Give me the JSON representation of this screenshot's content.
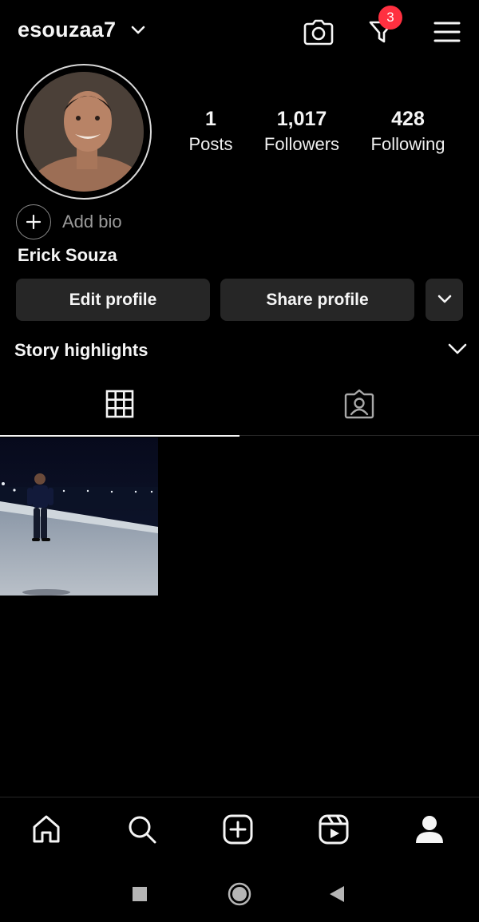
{
  "header": {
    "username": "esouzaa7",
    "notification_count": "3"
  },
  "profile": {
    "stats": {
      "posts_value": "1",
      "posts_label": "Posts",
      "followers_value": "1,017",
      "followers_label": "Followers",
      "following_value": "428",
      "following_label": "Following"
    },
    "add_bio_label": "Add bio",
    "full_name": "Erick Souza"
  },
  "actions": {
    "edit_profile_label": "Edit profile",
    "share_profile_label": "Share profile"
  },
  "highlights": {
    "label": "Story highlights"
  },
  "tabs": [
    {
      "icon": "grid-icon",
      "active": true
    },
    {
      "icon": "tagged-person-icon",
      "active": false
    }
  ],
  "posts": [
    {
      "type": "photo"
    }
  ],
  "bottom_nav": [
    "home-icon",
    "search-icon",
    "create-post-icon",
    "reels-icon",
    "profile-icon"
  ],
  "colors": {
    "background": "#000000",
    "button_bg": "#262626",
    "badge": "#ff3040",
    "text": "#f5f5f5",
    "muted": "#9a9a9a"
  }
}
